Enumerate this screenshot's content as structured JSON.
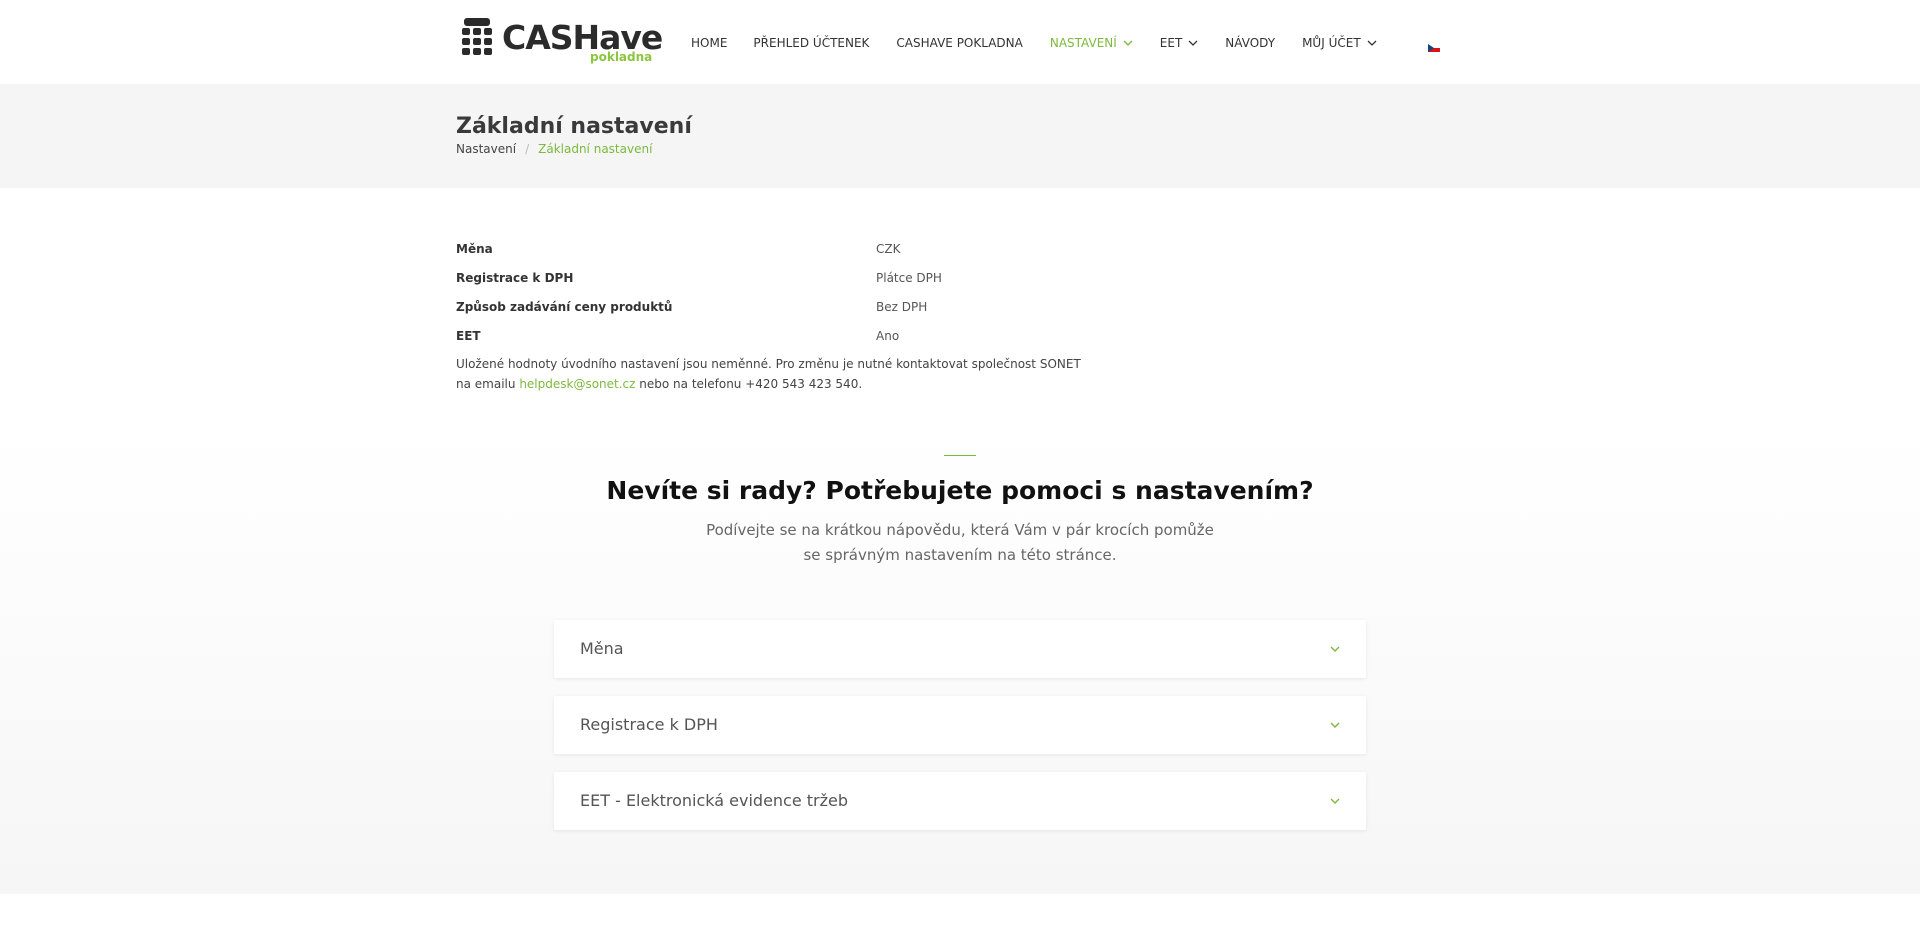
{
  "brand": {
    "name": "CASHave",
    "sub": "pokladna"
  },
  "nav": {
    "items": [
      {
        "label": "HOME"
      },
      {
        "label": "PŘEHLED ÚČTENEK"
      },
      {
        "label": "CASHAVE POKLADNA"
      },
      {
        "label": "NASTAVENÍ"
      },
      {
        "label": "EET"
      },
      {
        "label": "NÁVODY"
      },
      {
        "label": "MŮJ ÚČET"
      }
    ]
  },
  "colors": {
    "accent": "#7cb93e",
    "brand_green": "#8cc63e",
    "title_bg": "#f5f5f5"
  },
  "page": {
    "title": "Základní nastavení",
    "breadcrumb": {
      "parent": "Nastavení",
      "separator": "/",
      "current": "Základní nastavení"
    }
  },
  "settings": {
    "rows": [
      {
        "key": "Měna",
        "value": "CZK"
      },
      {
        "key": "Registrace k DPH",
        "value": "Plátce DPH"
      },
      {
        "key": "Způsob zadávání ceny produktů",
        "value": "Bez DPH"
      },
      {
        "key": "EET",
        "value": "Ano"
      }
    ],
    "note_text1": "Uložené hodnoty úvodního nastavení jsou neměnné. Pro změnu je nutné kontaktovat společnost SONET na emailu",
    "note_email": "helpdesk@sonet.cz",
    "note_text2": "nebo na telefonu +420 543 423 540."
  },
  "help": {
    "title": "Nevíte si rady? Potřebujete pomoci s nastavením?",
    "subtitle": "Podívejte se na krátkou nápovědu, která Vám v pár krocích pomůže se správným nastavením na této stránce.",
    "accordion": [
      {
        "label": "Měna"
      },
      {
        "label": "Registrace k DPH"
      },
      {
        "label": "EET - Elektronická evidence tržeb"
      }
    ]
  },
  "language": {
    "flag_icon": "czech-flag-icon"
  }
}
